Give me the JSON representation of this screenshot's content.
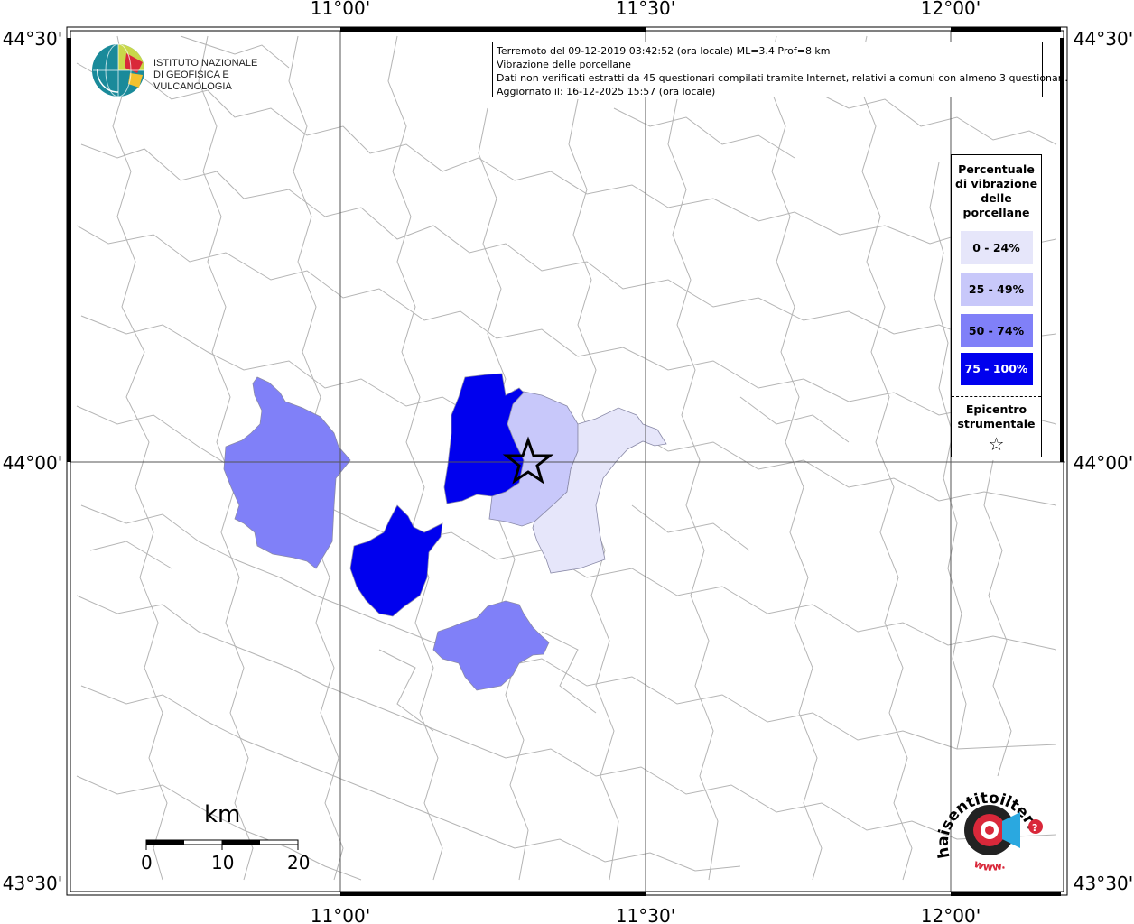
{
  "info": {
    "line1": "Terremoto del 09-12-2019 03:42:52 (ora locale) ML=3.4 Prof=8 km",
    "line2": "Vibrazione delle porcellane",
    "line3": "Dati non verificati estratti da 45 questionari compilati tramite Internet, relativi a comuni con almeno 3 questionari.",
    "line4": "Aggiornato il: 16-12-2025 15:57 (ora locale)"
  },
  "legend": {
    "title_line1": "Percentuale",
    "title_line2": "di vibrazione",
    "title_line3": "delle",
    "title_line4": "porcellane",
    "classes": [
      {
        "label": "0 - 24%",
        "color": "#e6e6fa",
        "text_color": "#000000"
      },
      {
        "label": "25 - 49%",
        "color": "#c8c8fa",
        "text_color": "#000000"
      },
      {
        "label": "50 - 74%",
        "color": "#8080f8",
        "text_color": "#000000"
      },
      {
        "label": "75 - 100%",
        "color": "#0000ee",
        "text_color": "#ffffff"
      }
    ],
    "epicentre_line1": "Epicentro",
    "epicentre_line2": "strumentale",
    "epicentre_symbol": "☆"
  },
  "axes": {
    "top": [
      "11°00'",
      "11°30'",
      "12°00'"
    ],
    "bottom": [
      "11°00'",
      "11°30'",
      "12°00'"
    ],
    "left": [
      "44°30'",
      "44°00'",
      "43°30'"
    ],
    "right": [
      "44°30'",
      "44°00'",
      "43°30'"
    ]
  },
  "ingv_logo": {
    "line1": "ISTITUTO NAZIONALE",
    "line2": "DI GEOFISICA E VULCANOLOGIA"
  },
  "scale_bar": {
    "unit": "km",
    "labels": [
      "0",
      "10",
      "20"
    ]
  },
  "hst_logo": {
    "text": "haisentitoilterremoto.it",
    "www": "www."
  }
}
